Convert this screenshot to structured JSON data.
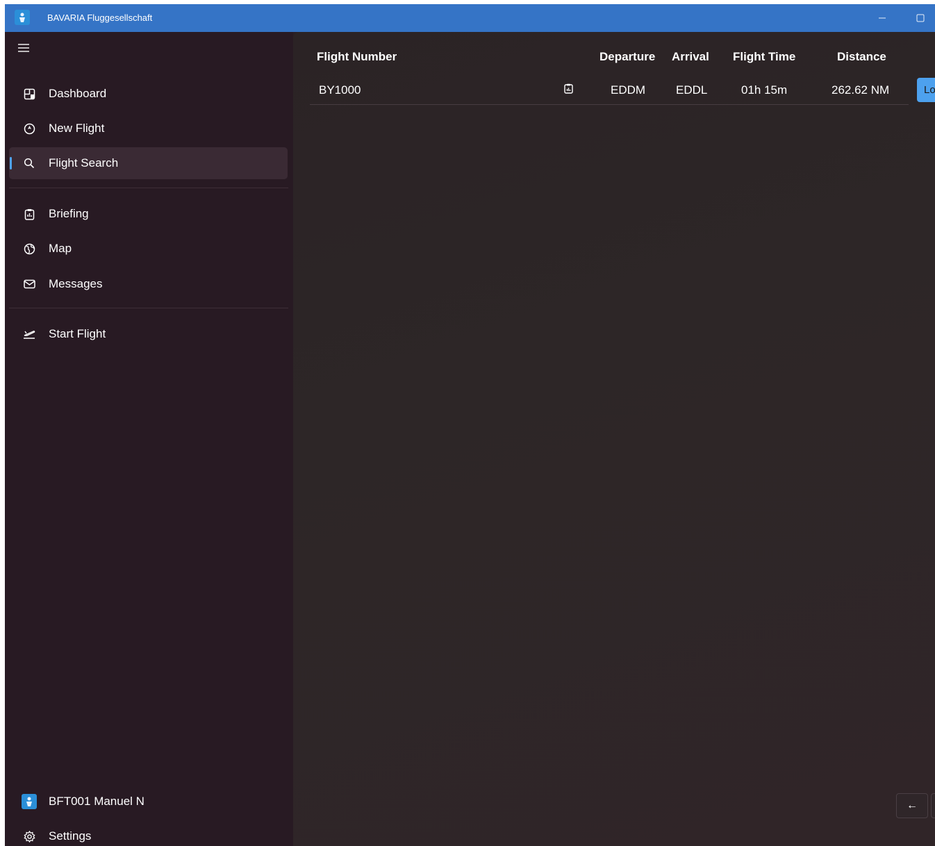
{
  "window": {
    "title": "BAVARIA Fluggesellschaft"
  },
  "sidebar": {
    "items": [
      {
        "label": "Dashboard",
        "icon": "dashboard-icon"
      },
      {
        "label": "New Flight",
        "icon": "new-flight-icon"
      },
      {
        "label": "Flight Search",
        "icon": "search-icon",
        "selected": true
      },
      {
        "label": "Briefing",
        "icon": "clipboard-icon"
      },
      {
        "label": "Map",
        "icon": "globe-icon"
      },
      {
        "label": "Messages",
        "icon": "mail-icon"
      },
      {
        "label": "Start Flight",
        "icon": "takeoff-icon"
      }
    ],
    "footer": {
      "user_label": "BFT001 Manuel N",
      "settings_label": "Settings"
    }
  },
  "table": {
    "headers": {
      "flight_number": "Flight Number",
      "departure": "Departure",
      "arrival": "Arrival",
      "flight_time": "Flight Time",
      "distance": "Distance"
    },
    "rows": [
      {
        "flight_number": "BY1000",
        "departure": "EDDM",
        "arrival": "EDDL",
        "flight_time": "01h 15m",
        "distance": "262.62 NM",
        "action_label": "Lo"
      }
    ]
  },
  "pager": {
    "prev_glyph": "←"
  },
  "colors": {
    "titlebar": "#3574c6",
    "sidebar_bg": "#281a23",
    "main_bg": "#2d2627",
    "accent": "#4ea3f0"
  }
}
